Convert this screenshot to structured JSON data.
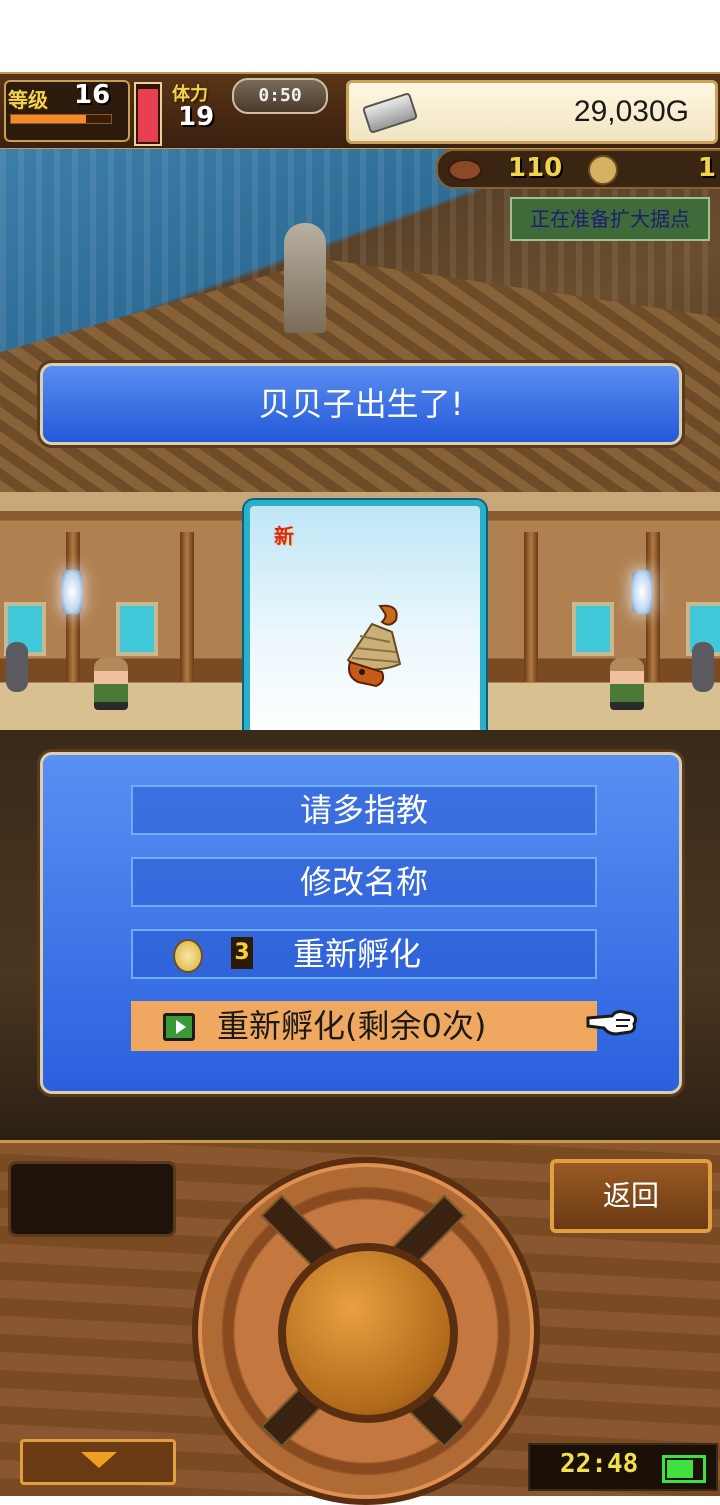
{
  "hud": {
    "level_label": "等级",
    "level_value": "16",
    "level_progress": 0.75,
    "hp_fraction": 0.95,
    "stamina_label": "体力",
    "stamina_value": "19",
    "timer": "0:50",
    "gold": "29,030G"
  },
  "resources": {
    "meat": "110",
    "coin": "1"
  },
  "notice": "正在准备扩大据点",
  "banner": "贝贝子出生了!",
  "egg_card": {
    "new_tag": "新",
    "creature_icon": "hermit-crab-icon"
  },
  "menu": {
    "items": [
      {
        "label": "请多指教"
      },
      {
        "label": "修改名称"
      },
      {
        "label": "重新孵化",
        "cost": "3",
        "cost_icon": "coin-icon"
      },
      {
        "label": "重新孵化(剩余0次)",
        "icon": "video-icon",
        "selected": true
      }
    ],
    "pointer_icon": "pointing-hand-icon"
  },
  "panel": {
    "back_label": "返回",
    "clock": "22:48",
    "battery_level": 0.8
  },
  "colors": {
    "menu_blue": "#2a60de",
    "selected_orange": "#f0a860",
    "card_border": "#2ab0c8",
    "notice_green": "#3f6b3a"
  }
}
